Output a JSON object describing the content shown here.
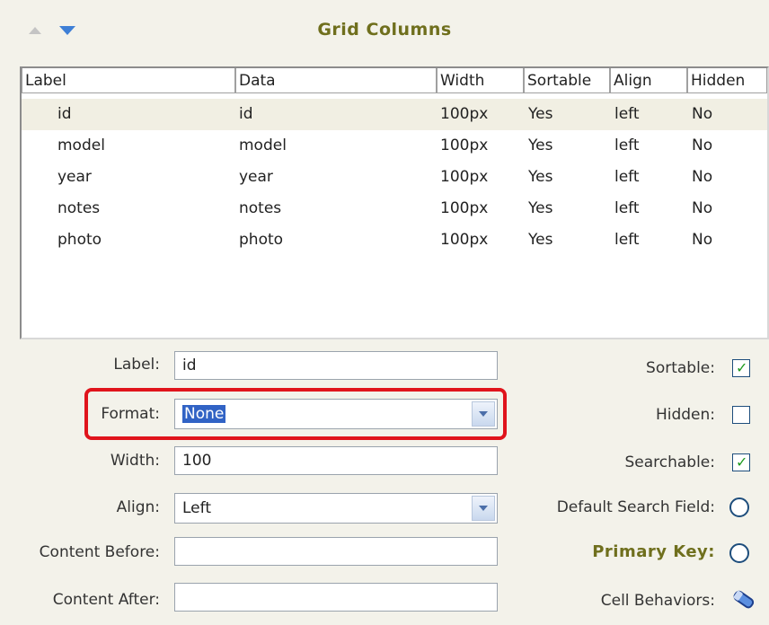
{
  "header": {
    "title": "Grid Columns",
    "move_up_icon": "arrow-up-icon",
    "move_down_icon": "arrow-down-icon"
  },
  "table": {
    "columns": [
      "Label",
      "Data",
      "Width",
      "Sortable",
      "Align",
      "Hidden"
    ],
    "rows": [
      [
        "id",
        "id",
        "100px",
        "Yes",
        "left",
        "No"
      ],
      [
        "model",
        "model",
        "100px",
        "Yes",
        "left",
        "No"
      ],
      [
        "year",
        "year",
        "100px",
        "Yes",
        "left",
        "No"
      ],
      [
        "notes",
        "notes",
        "100px",
        "Yes",
        "left",
        "No"
      ],
      [
        "photo",
        "photo",
        "100px",
        "Yes",
        "left",
        "No"
      ]
    ],
    "selected_row": 0
  },
  "form": {
    "label_label": "Label:",
    "label_value": "id",
    "format_label": "Format:",
    "format_value": "None",
    "width_label": "Width:",
    "width_value": "100",
    "align_label": "Align:",
    "align_value": "Left",
    "content_before_label": "Content Before:",
    "content_before_value": "",
    "content_after_label": "Content After:",
    "content_after_value": "",
    "sortable_label": "Sortable:",
    "sortable_checked": true,
    "hidden_label": "Hidden:",
    "hidden_checked": false,
    "searchable_label": "Searchable:",
    "searchable_checked": true,
    "default_search_label": "Default Search Field:",
    "primary_key_label": "Primary Key:",
    "cell_behaviors_label": "Cell Behaviors:",
    "cell_behaviors_icon": "pencil-icon"
  },
  "colors": {
    "title": "#6f6f1d",
    "highlight_box": "#e0141c",
    "selection": "#3163c5",
    "check": "#1e9a1e"
  }
}
